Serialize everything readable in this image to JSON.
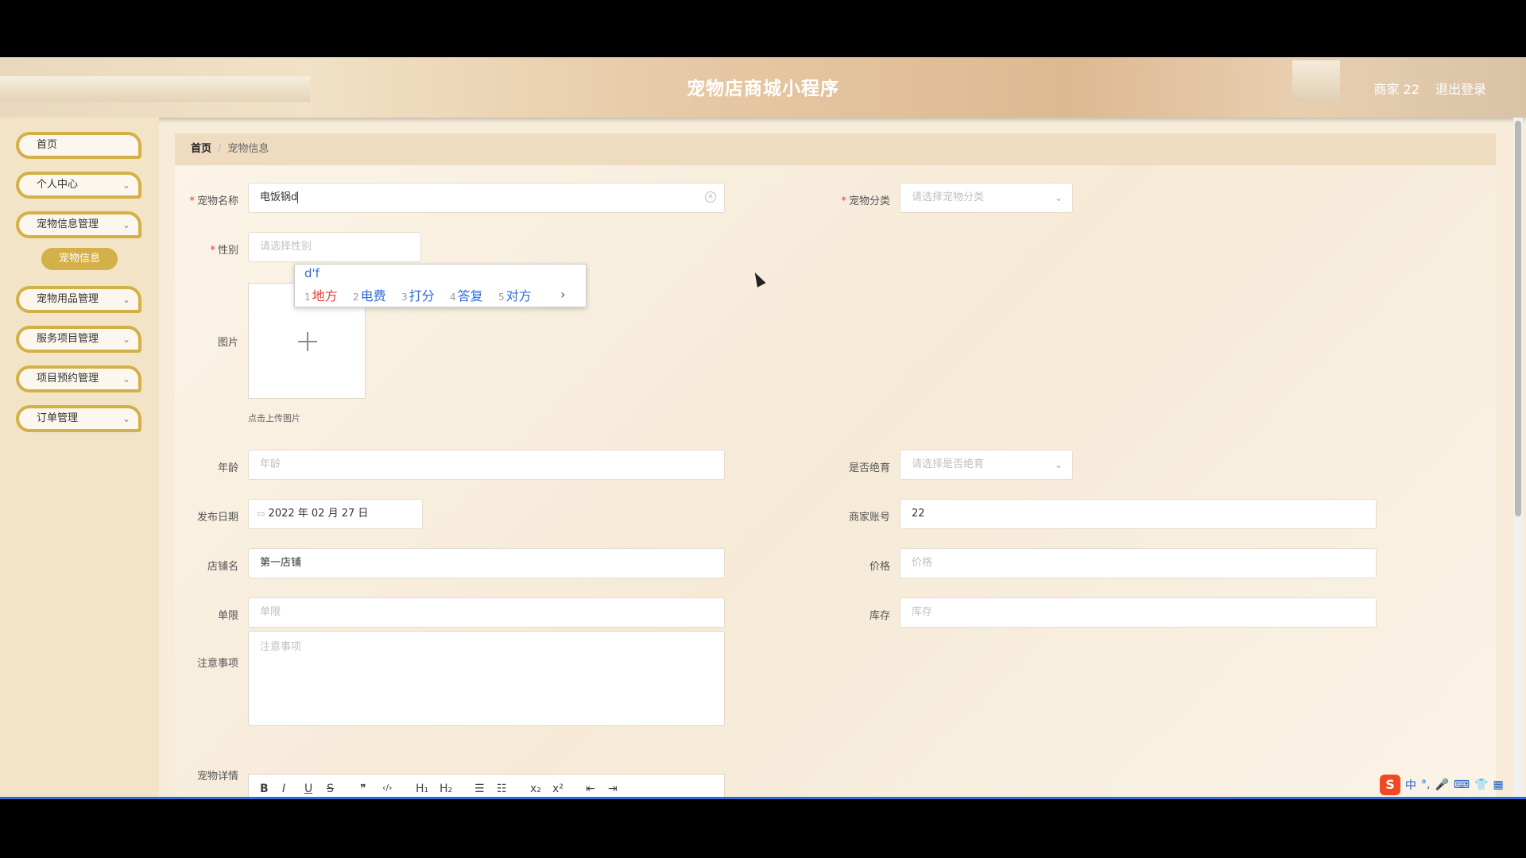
{
  "header": {
    "title": "宠物店商城小程序",
    "user": "商家 22",
    "logout": "退出登录"
  },
  "sidebar": {
    "items": [
      {
        "label": "首页"
      },
      {
        "label": "个人中心"
      },
      {
        "label": "宠物信息管理"
      },
      {
        "label": "宠物用品管理"
      },
      {
        "label": "服务项目管理"
      },
      {
        "label": "项目预约管理"
      },
      {
        "label": "订单管理"
      }
    ],
    "active_sub": "宠物信息"
  },
  "breadcrumb": {
    "home": "首页",
    "current": "宠物信息"
  },
  "form": {
    "pet_name": {
      "label": "宠物名称",
      "value": "电饭锅d"
    },
    "pet_category": {
      "label": "宠物分类",
      "placeholder": "请选择宠物分类"
    },
    "gender": {
      "label": "性别",
      "placeholder": "请选择性别"
    },
    "image": {
      "label": "图片",
      "tip": "点击上传图片"
    },
    "age": {
      "label": "年龄",
      "placeholder": "年龄"
    },
    "sterilized": {
      "label": "是否绝育",
      "placeholder": "请选择是否绝育"
    },
    "publish_date": {
      "label": "发布日期",
      "value": "2022 年 02 月 27 日"
    },
    "merchant_account": {
      "label": "商家账号",
      "value": "22"
    },
    "shop_name": {
      "label": "店铺名",
      "value": "第一店铺"
    },
    "price": {
      "label": "价格",
      "placeholder": "价格"
    },
    "limit": {
      "label": "单限",
      "placeholder": "单限"
    },
    "stock": {
      "label": "库存",
      "placeholder": "库存"
    },
    "notes": {
      "label": "注意事项",
      "placeholder": "注意事项"
    },
    "details": {
      "label": "宠物详情"
    }
  },
  "editor_toolbar": [
    "B",
    "I",
    "U",
    "S",
    "❞",
    "‹/›",
    "H₁",
    "H₂",
    "☰",
    "☷",
    "x₂",
    "x²",
    "⇤",
    "⇥"
  ],
  "ime": {
    "composition": "d'f",
    "candidates": [
      {
        "num": "1",
        "text": "地方"
      },
      {
        "num": "2",
        "text": "电费"
      },
      {
        "num": "3",
        "text": "打分"
      },
      {
        "num": "4",
        "text": "答复"
      },
      {
        "num": "5",
        "text": "对方"
      }
    ],
    "next": "›"
  },
  "taskbar": {
    "logo": "S",
    "lang": "中",
    "punct": "°,",
    "icons": [
      "🎤",
      "⌨",
      "👕",
      "▦"
    ]
  }
}
